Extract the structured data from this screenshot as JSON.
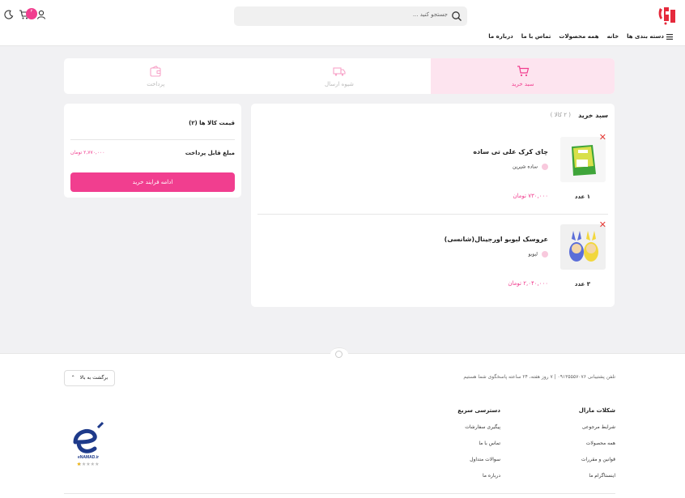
{
  "header": {
    "logo_text": "بیگل",
    "search_placeholder": "جستجو کنید ...",
    "cart_badge": "۲",
    "nav": [
      "دسته بندی ها",
      "خانه",
      "همه محصولات",
      "تماس با ما",
      "درباره ما"
    ]
  },
  "steps": [
    {
      "label": "سبد خرید",
      "icon": "cart-icon",
      "active": true
    },
    {
      "label": "شیوه ارسال",
      "icon": "truck-icon",
      "active": false
    },
    {
      "label": "پرداخت",
      "icon": "wallet-icon",
      "active": false
    }
  ],
  "cart": {
    "title": "سبد خرید",
    "count": "( ۲ کالا )",
    "items": [
      {
        "name": "چای کرک علی تی ساده",
        "variant": "ساده شیرین",
        "qty": "۱ عدد",
        "price": "۷۳۰,۰۰۰ تومان"
      },
      {
        "name": "عروسک لبوبو اورجینال(شانسی)",
        "variant": "لبوبو",
        "qty": "۳ عدد",
        "price": "۲,۰۴۰,۰۰۰ تومان"
      }
    ]
  },
  "summary": {
    "items_price_label": "قیمت کالا ها (۲)",
    "payable_label": "مبلغ قابل پرداخت",
    "payable_value": "۲,۷۷۰,۰۰۰ تومان",
    "continue_button": "ادامه فرایند خرید"
  },
  "footer": {
    "support": "تلفن پشتیبانی ۰۹۱۳۵۵۵۷۰۷۶   |   ۷ روز هفته، ۲۴ ساعته پاسخگوی شما هستیم",
    "back_to_top": "برگشت به بالا",
    "col1_title": "شکلات مارال",
    "col1_links": [
      "شرایط مرجوعی",
      "همه محصولات",
      "قوانین و مقررات",
      "اینستاگرام ما"
    ],
    "col2_title": "دسترسی سریع",
    "col2_links": [
      "پیگیری سفارشات",
      "تماس با ما",
      "سوالات متداول",
      "درباره ما"
    ],
    "enamad_text": "eNAMAD.ir"
  },
  "colors": {
    "accent": "#f13e8f",
    "accent_light": "#fde4ef"
  }
}
